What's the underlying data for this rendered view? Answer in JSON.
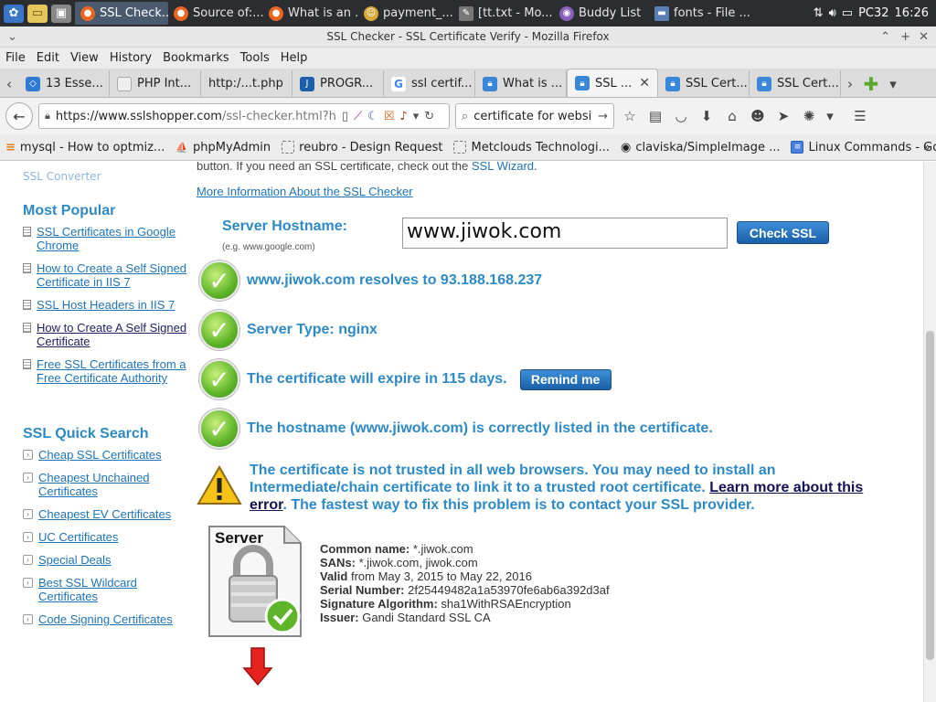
{
  "taskbar": {
    "tasks": [
      {
        "label": "SSL Check...",
        "active": true
      },
      {
        "label": "Source of:...",
        "active": false
      },
      {
        "label": "What is an ...",
        "active": false
      },
      {
        "label": "payment_...",
        "active": false
      },
      {
        "label": "[tt.txt - Mo...",
        "active": false
      },
      {
        "label": "Buddy List",
        "active": false
      },
      {
        "label": "fonts - File ...",
        "active": false
      }
    ],
    "hostname": "PC32",
    "clock": "16:26"
  },
  "window": {
    "title": "SSL Checker - SSL Certificate Verify - Mozilla Firefox"
  },
  "menu": [
    "File",
    "Edit",
    "View",
    "History",
    "Bookmarks",
    "Tools",
    "Help"
  ],
  "tabs": [
    {
      "label": "13 Esse...",
      "icon": "blue"
    },
    {
      "label": "PHP Int...",
      "icon": "doc"
    },
    {
      "label": "http:/...t.php",
      "icon": "none"
    },
    {
      "label": "PROGR...",
      "icon": "blue"
    },
    {
      "label": "ssl certif...",
      "icon": "google"
    },
    {
      "label": "What is ...",
      "icon": "lock"
    },
    {
      "label": "SSL ...",
      "icon": "lock",
      "active": true
    },
    {
      "label": "SSL Cert...",
      "icon": "lock"
    },
    {
      "label": "SSL Cert...",
      "icon": "lock"
    }
  ],
  "nav": {
    "url_host": "https://www.sslshopper.com",
    "url_rest": "/ssl-checker.html?h",
    "search_value": "certificate for website"
  },
  "bookmarks": [
    {
      "label": "mysql - How to optmiz..."
    },
    {
      "label": "phpMyAdmin"
    },
    {
      "label": "reubro - Design Request"
    },
    {
      "label": "Metclouds Technologi..."
    },
    {
      "label": "claviska/SimpleImage ..."
    },
    {
      "label": "Linux Commands - Go..."
    }
  ],
  "sidebar": {
    "top_link": "SSL Converter",
    "popular_heading": "Most Popular",
    "popular": [
      {
        "label": "SSL Certificates in Google Chrome"
      },
      {
        "label": "How to Create a Self Signed Certificate in IIS 7"
      },
      {
        "label": "SSL Host Headers in IIS 7"
      },
      {
        "label": "How to Create A Self Signed Certificate",
        "visited": true
      },
      {
        "label": "Free SSL Certificates from a Free Certificate Authority"
      }
    ],
    "quick_heading": "SSL Quick Search",
    "quick": [
      {
        "label": "Cheap SSL Certificates"
      },
      {
        "label": "Cheapest Unchained Certificates"
      },
      {
        "label": "Cheapest EV Certificates"
      },
      {
        "label": "UC Certificates"
      },
      {
        "label": "Special Deals"
      },
      {
        "label": "Best SSL Wildcard Certificates"
      },
      {
        "label": "Code Signing Certificates"
      }
    ]
  },
  "main": {
    "intro_text": "button. If you need an SSL certificate, check out the ",
    "intro_link": "SSL Wizard",
    "intro_end": ".",
    "more_info": "More Information About the SSL Checker",
    "hostname_label": "Server Hostname:",
    "hostname_example": "(e.g. www.google.com)",
    "hostname_value": "www.jiwok.com",
    "check_button": "Check SSL",
    "results": [
      {
        "text": "www.jiwok.com resolves to 93.188.168.237"
      },
      {
        "text": "Server Type: nginx"
      },
      {
        "text": "The certificate will expire in 115 days.",
        "button": "Remind me"
      },
      {
        "text": "The hostname (www.jiwok.com) is correctly listed in the certificate."
      }
    ],
    "warning": {
      "text": "The certificate is not trusted in all web browsers. You may need to install an Intermediate/chain certificate to link it to a trusted root certificate. ",
      "link": "Learn more about this error",
      "end": ". The fastest way to fix this problem is to contact your SSL provider."
    },
    "server_label": "Server",
    "cert": {
      "common_name_k": "Common name:",
      "common_name_v": " *.jiwok.com",
      "sans_k": "SANs:",
      "sans_v": " *.jiwok.com, jiwok.com",
      "valid_k": "Valid",
      "valid_v": " from May 3, 2015 to May 22, 2016",
      "serial_k": "Serial Number:",
      "serial_v": " 2f25449482a1a53970fe6ab6a392d3af",
      "sig_k": "Signature Algorithm:",
      "sig_v": " sha1WithRSAEncryption",
      "issuer_k": "Issuer:",
      "issuer_v": " Gandi Standard SSL CA"
    }
  }
}
